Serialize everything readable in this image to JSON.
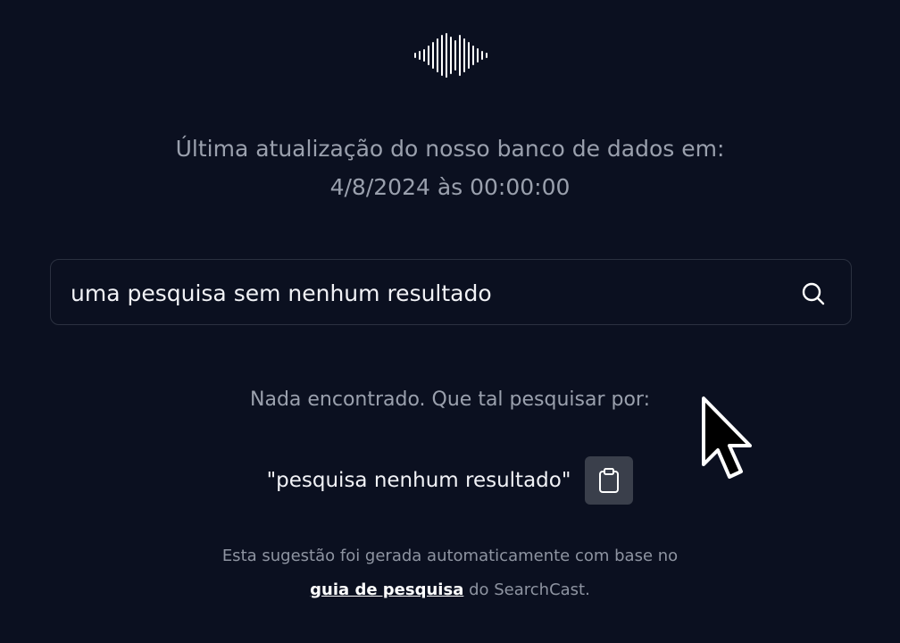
{
  "logo": {
    "icon": "waveform-icon"
  },
  "update_notice": {
    "line1": "Última atualização do nosso banco de dados em:",
    "line2": "4/8/2024 às 00:00:00"
  },
  "search": {
    "value": "uma pesquisa sem nenhum resultado",
    "placeholder": "",
    "icon": "search-icon"
  },
  "results": {
    "empty_message": "Nada encontrado. Que tal pesquisar por:",
    "suggestion": "\"pesquisa nenhum resultado\"",
    "copy_icon": "clipboard-icon"
  },
  "footnote": {
    "line1": "Esta sugestão foi gerada automaticamente com base no",
    "link_text": "guia de pesquisa",
    "line2_suffix": " do SearchCast."
  },
  "colors": {
    "background": "#0b1020",
    "muted_text": "#9aa0ad",
    "primary_text": "#f1f2f6",
    "border": "#2b3140",
    "button_bg": "#3a3f4b"
  }
}
